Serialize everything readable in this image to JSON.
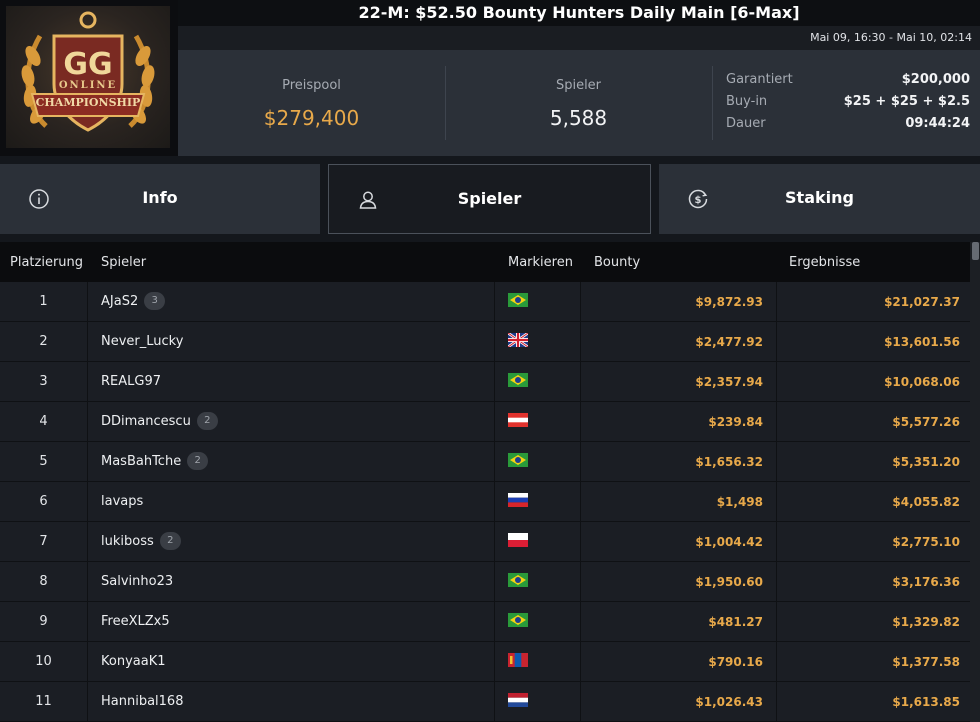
{
  "logo": {
    "line1": "ONLINE",
    "line2": "CHAMPIONSHIP"
  },
  "header": {
    "title": "22-M: $52.50 Bounty Hunters Daily Main [6-Max]",
    "dates": "Mai 09, 16:30 - Mai 10, 02:14"
  },
  "stats": {
    "prizepool_label": "Preispool",
    "prizepool_value": "$279,400",
    "players_label": "Spieler",
    "players_value": "5,588",
    "details": [
      {
        "label": "Garantiert",
        "value": "$200,000"
      },
      {
        "label": "Buy-in",
        "value": "$25 + $25 + $2.5"
      },
      {
        "label": "Dauer",
        "value": "09:44:24"
      }
    ]
  },
  "tabs": [
    {
      "label": "Info",
      "icon": "info-icon"
    },
    {
      "label": "Spieler",
      "icon": "user-icon"
    },
    {
      "label": "Staking",
      "icon": "dollar-coin-icon"
    }
  ],
  "table": {
    "headers": [
      "Platzierung",
      "Spieler",
      "Markieren",
      "Bounty",
      "Ergebnisse"
    ],
    "rows": [
      {
        "place": "1",
        "name": "AJaS2",
        "badge": "3",
        "flag": "brazil",
        "bounty": "$9,872.93",
        "result": "$21,027.37"
      },
      {
        "place": "2",
        "name": "Never_Lucky",
        "badge": "",
        "flag": "uk",
        "bounty": "$2,477.92",
        "result": "$13,601.56"
      },
      {
        "place": "3",
        "name": "REALG97",
        "badge": "",
        "flag": "brazil",
        "bounty": "$2,357.94",
        "result": "$10,068.06"
      },
      {
        "place": "4",
        "name": "DDimancescu",
        "badge": "2",
        "flag": "austria",
        "bounty": "$239.84",
        "result": "$5,577.26"
      },
      {
        "place": "5",
        "name": "MasBahTche",
        "badge": "2",
        "flag": "brazil",
        "bounty": "$1,656.32",
        "result": "$5,351.20"
      },
      {
        "place": "6",
        "name": "lavaps",
        "badge": "",
        "flag": "russia",
        "bounty": "$1,498",
        "result": "$4,055.82"
      },
      {
        "place": "7",
        "name": "lukiboss",
        "badge": "2",
        "flag": "poland",
        "bounty": "$1,004.42",
        "result": "$2,775.10"
      },
      {
        "place": "8",
        "name": "Salvinho23",
        "badge": "",
        "flag": "brazil",
        "bounty": "$1,950.60",
        "result": "$3,176.36"
      },
      {
        "place": "9",
        "name": "FreeXLZx5",
        "badge": "",
        "flag": "brazil",
        "bounty": "$481.27",
        "result": "$1,329.82"
      },
      {
        "place": "10",
        "name": "KonyaaK1",
        "badge": "",
        "flag": "mongolia",
        "bounty": "$790.16",
        "result": "$1,377.58"
      },
      {
        "place": "11",
        "name": "Hannibal168",
        "badge": "",
        "flag": "netherlands",
        "bounty": "$1,026.43",
        "result": "$1,613.85"
      }
    ]
  },
  "colors": {
    "accent": "#e8a94a",
    "panel": "#2b3038",
    "row": "#1b1e24",
    "header": "#0b0c0e"
  }
}
